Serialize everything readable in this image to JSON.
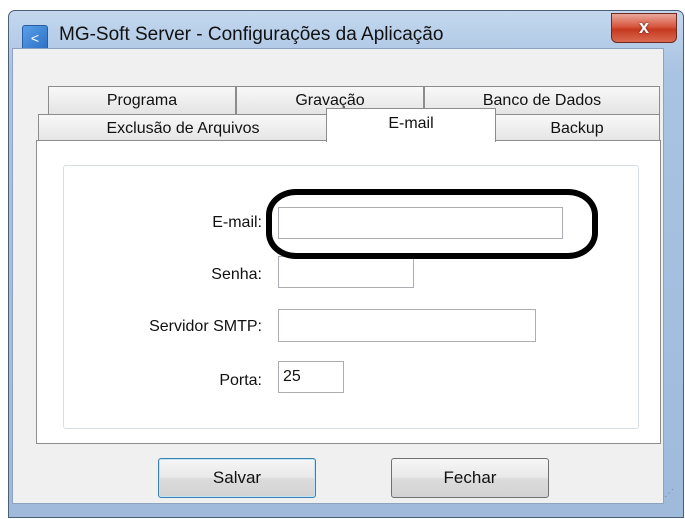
{
  "window": {
    "title": "MG-Soft Server - Configurações da Aplicação",
    "close_label": "x"
  },
  "tabs": {
    "row1": [
      {
        "label": "Programa"
      },
      {
        "label": "Gravação"
      },
      {
        "label": "Banco de Dados"
      }
    ],
    "row2": [
      {
        "label": "Exclusão de Arquivos"
      },
      {
        "label": "E-mail",
        "active": true
      },
      {
        "label": "Backup"
      }
    ]
  },
  "form": {
    "email": {
      "label": "E-mail:",
      "value": ""
    },
    "senha": {
      "label": "Senha:",
      "value": ""
    },
    "smtp": {
      "label": "Servidor SMTP:",
      "value": ""
    },
    "porta": {
      "label": "Porta:",
      "value": "25"
    }
  },
  "buttons": {
    "save": "Salvar",
    "close": "Fechar"
  },
  "colors": {
    "titlebar": "#a9c3e2",
    "close_button": "#c5391f",
    "default_button_border": "#3c7fb1"
  }
}
